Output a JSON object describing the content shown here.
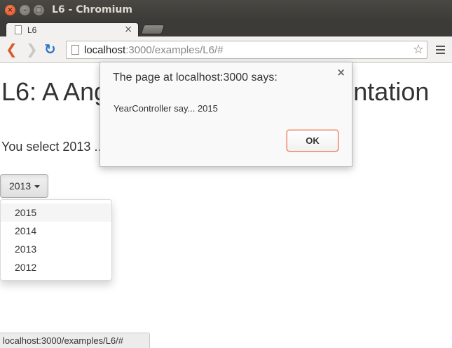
{
  "window": {
    "title": "L6 - Chromium",
    "close_glyph": "×",
    "min_glyph": "–",
    "max_glyph": "□"
  },
  "tab": {
    "label": "L6",
    "close_glyph": "×"
  },
  "toolbar": {
    "url_host": "localhost",
    "url_path": ":3000/examples/L6/#",
    "back_glyph": "❮",
    "forward_glyph": "❯",
    "reload_glyph": "↻",
    "star_glyph": "☆"
  },
  "page": {
    "title": "L6: A Angular directive implementation",
    "selection_text": "You select 2013 ...",
    "dropdown": {
      "selected": "2013",
      "options": [
        "2015",
        "2014",
        "2013",
        "2012"
      ]
    }
  },
  "dialog": {
    "title": "The page at localhost:3000 says:",
    "message": "YearController say... 2015",
    "ok_label": "OK",
    "close_glyph": "×"
  },
  "statusbar": {
    "text": "localhost:3000/examples/L6/#"
  },
  "colors": {
    "accent_orange": "#d95b2a",
    "reload_blue": "#2f76c7",
    "ok_border": "#e6805e"
  }
}
